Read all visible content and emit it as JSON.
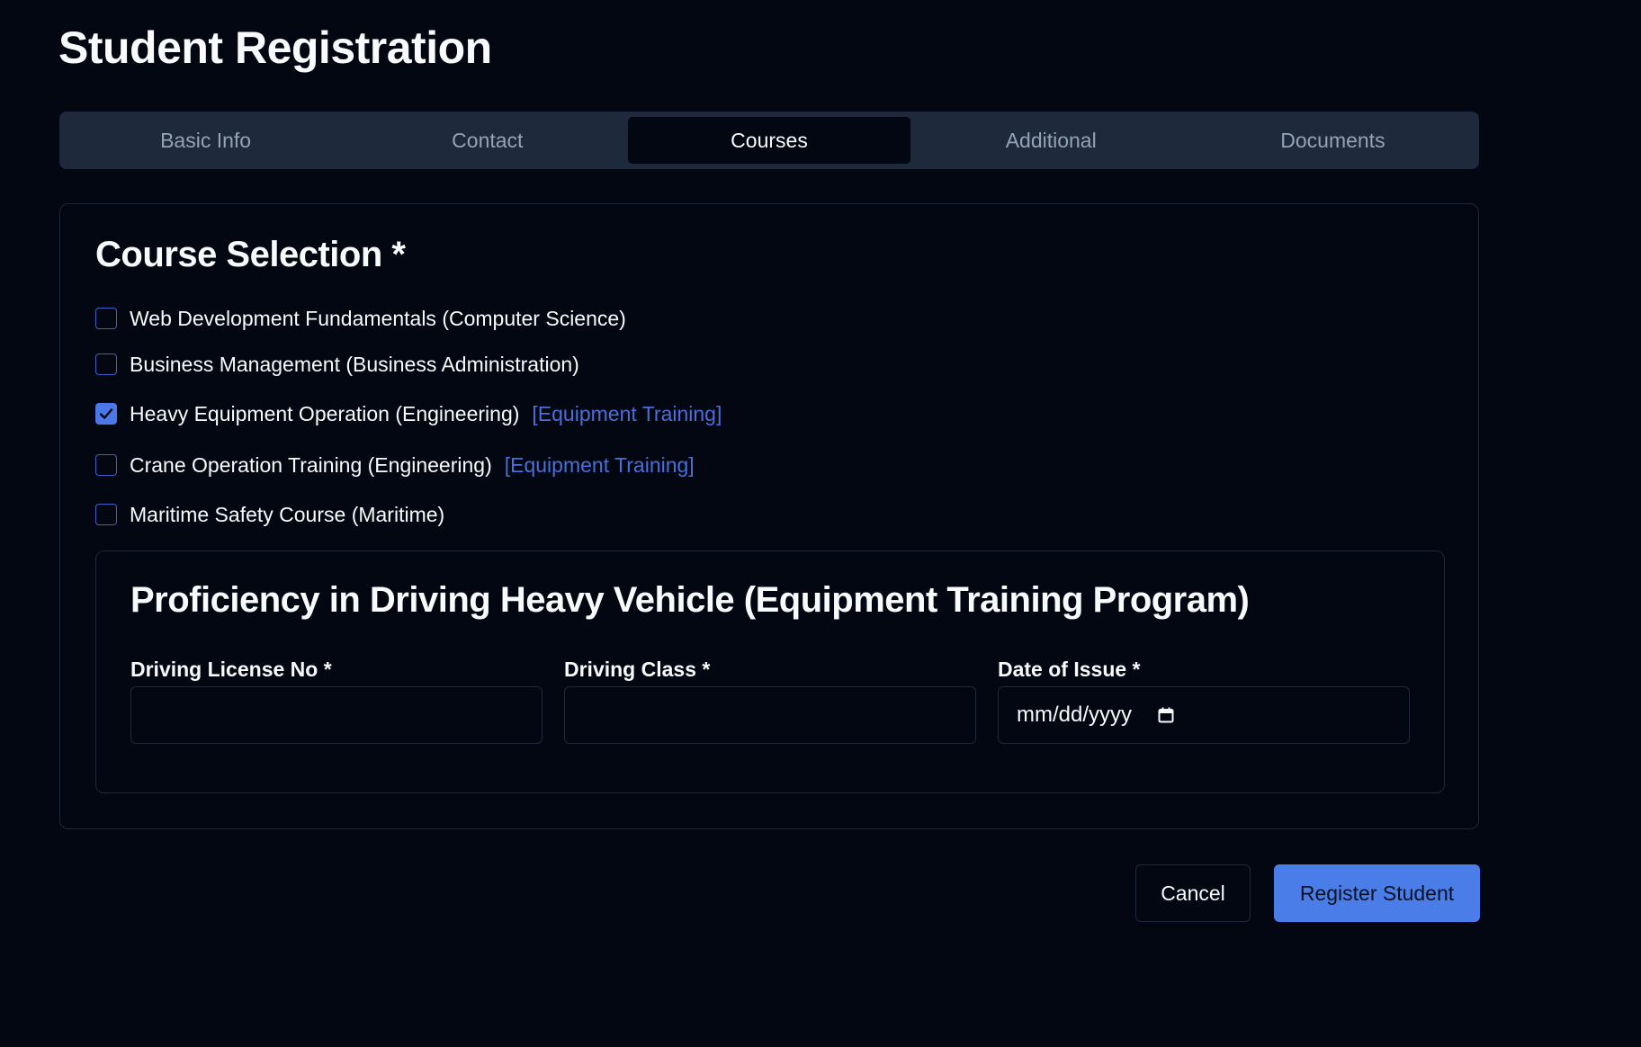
{
  "page": {
    "title": "Student Registration"
  },
  "tabs": [
    {
      "label": "Basic Info",
      "active": false
    },
    {
      "label": "Contact",
      "active": false
    },
    {
      "label": "Courses",
      "active": true
    },
    {
      "label": "Additional",
      "active": false
    },
    {
      "label": "Documents",
      "active": false
    }
  ],
  "courses": {
    "title": "Course Selection *",
    "items": [
      {
        "label": "Web Development Fundamentals (Computer Science)",
        "checked": false,
        "tag": ""
      },
      {
        "label": "Business Management (Business Administration)",
        "checked": false,
        "tag": ""
      },
      {
        "label": "Heavy Equipment Operation (Engineering)",
        "checked": true,
        "tag": "[Equipment Training]"
      },
      {
        "label": "Crane Operation Training (Engineering)",
        "checked": false,
        "tag": "[Equipment Training]"
      },
      {
        "label": "Maritime Safety Course (Maritime)",
        "checked": false,
        "tag": ""
      }
    ]
  },
  "proficiency": {
    "title": "Proficiency in Driving Heavy Vehicle (Equipment Training Program)",
    "fields": {
      "license": {
        "label": "Driving License No *",
        "value": ""
      },
      "class": {
        "label": "Driving Class *",
        "value": ""
      },
      "issue_date": {
        "label": "Date of Issue *",
        "placeholder": "mm/dd/yyyy"
      }
    }
  },
  "actions": {
    "cancel_label": "Cancel",
    "submit_label": "Register Student"
  },
  "colors": {
    "background": "#030711",
    "tab_bar": "#1e293b",
    "accent": "#4a7de8",
    "tag": "#4a6fd8"
  },
  "icons": {
    "check": "check-icon",
    "calendar": "calendar-icon"
  }
}
